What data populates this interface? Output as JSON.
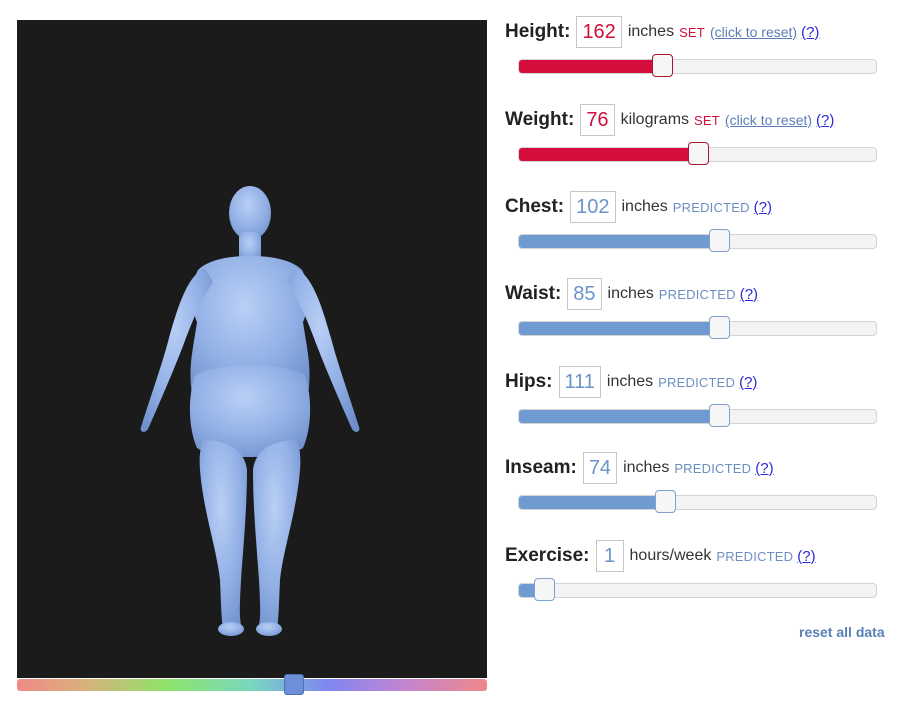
{
  "viewer": {
    "color_slider_level": 0.59
  },
  "metrics": [
    {
      "label": "Height:",
      "value": "162",
      "unit": "inches",
      "status": "SET",
      "reset": "(click to reset)",
      "help": "(?)",
      "level": 0.4
    },
    {
      "label": "Weight:",
      "value": "76",
      "unit": "kilograms",
      "status": "SET",
      "reset": "(click to reset)",
      "help": "(?)",
      "level": 0.5
    },
    {
      "label": "Chest:",
      "value": "102",
      "unit": "inches",
      "status": "PREDICTED",
      "help": "(?)",
      "level": 0.56
    },
    {
      "label": "Waist:",
      "value": "85",
      "unit": "inches",
      "status": "PREDICTED",
      "help": "(?)",
      "level": 0.56
    },
    {
      "label": "Hips:",
      "value": "111",
      "unit": "inches",
      "status": "PREDICTED",
      "help": "(?)",
      "level": 0.56
    },
    {
      "label": "Inseam:",
      "value": "74",
      "unit": "inches",
      "status": "PREDICTED",
      "help": "(?)",
      "level": 0.41
    },
    {
      "label": "Exercise:",
      "value": "1",
      "unit": "hours/week",
      "status": "PREDICTED",
      "help": "(?)",
      "level": 0.07
    }
  ],
  "reset_all": "reset all data",
  "colors": {
    "set": "#d40d3d",
    "predicted": "#6f9bd1",
    "body": "#9db9ea",
    "background": "#1b1b1b"
  }
}
